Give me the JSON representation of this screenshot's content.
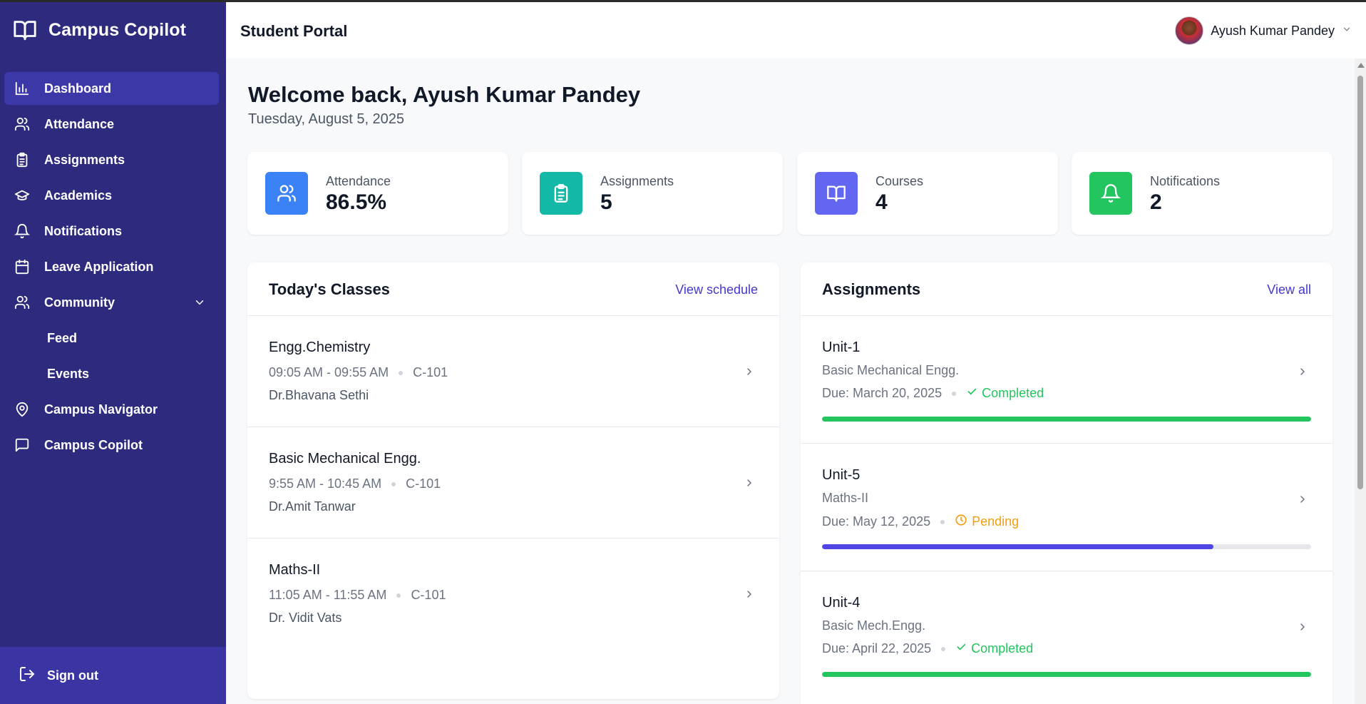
{
  "app": {
    "name": "Campus Copilot"
  },
  "sidebar": {
    "items": [
      {
        "label": "Dashboard",
        "icon": "bar-chart-icon"
      },
      {
        "label": "Attendance",
        "icon": "users-icon"
      },
      {
        "label": "Assignments",
        "icon": "clipboard-icon"
      },
      {
        "label": "Academics",
        "icon": "graduation-cap-icon"
      },
      {
        "label": "Notifications",
        "icon": "bell-icon"
      },
      {
        "label": "Leave Application",
        "icon": "calendar-icon"
      },
      {
        "label": "Community",
        "icon": "users-icon",
        "expanded": true,
        "children": [
          "Feed",
          "Events"
        ]
      },
      {
        "label": "Campus Navigator",
        "icon": "map-pin-icon"
      },
      {
        "label": "Campus Copilot",
        "icon": "message-icon"
      }
    ],
    "community_children": [
      "Feed",
      "Events"
    ],
    "signout": "Sign out"
  },
  "header": {
    "title": "Student Portal",
    "user_name": "Ayush Kumar Pandey"
  },
  "welcome": {
    "title": "Welcome back, Ayush Kumar Pandey",
    "date": "Tuesday, August 5, 2025"
  },
  "stats": [
    {
      "label": "Attendance",
      "value": "86.5%",
      "color": "#3b82f6",
      "icon": "users-icon"
    },
    {
      "label": "Assignments",
      "value": "5",
      "color": "#14b8a6",
      "icon": "clipboard-icon"
    },
    {
      "label": "Courses",
      "value": "4",
      "color": "#6366f1",
      "icon": "book-open-icon"
    },
    {
      "label": "Notifications",
      "value": "2",
      "color": "#22c55e",
      "icon": "bell-icon"
    }
  ],
  "classes": {
    "title": "Today's Classes",
    "link": "View schedule",
    "items": [
      {
        "name": "Engg.Chemistry",
        "time": "09:05 AM - 09:55 AM",
        "room": "C-101",
        "teacher": "Dr.Bhavana Sethi"
      },
      {
        "name": "Basic Mechanical Engg.",
        "time": "9:55 AM - 10:45 AM",
        "room": "C-101",
        "teacher": "Dr.Amit Tanwar"
      },
      {
        "name": "Maths-II",
        "time": "11:05 AM - 11:55 AM",
        "room": "C-101",
        "teacher": "Dr. Vidit Vats"
      }
    ]
  },
  "assignments": {
    "title": "Assignments",
    "link": "View all",
    "items": [
      {
        "name": "Unit-1",
        "course": "Basic Mechanical Engg.",
        "due": "Due: March 20, 2025",
        "status": "Completed",
        "progress": 1.0,
        "bar_color": "#22c55e"
      },
      {
        "name": "Unit-5",
        "course": "Maths-II",
        "due": "Due: May 12, 2025",
        "status": "Pending",
        "progress": 0.8,
        "bar_color": "#4f46e5"
      },
      {
        "name": "Unit-4",
        "course": "Basic Mech.Engg.",
        "due": "Due: April 22, 2025",
        "status": "Completed",
        "progress": 1.0,
        "bar_color": "#22c55e"
      }
    ]
  },
  "colors": {
    "sidebar_bg": "#2e2a7e",
    "sidebar_active": "#3d38a8",
    "accent_link": "#4338ca",
    "completed": "#22c55e",
    "pending": "#f59e0b"
  }
}
